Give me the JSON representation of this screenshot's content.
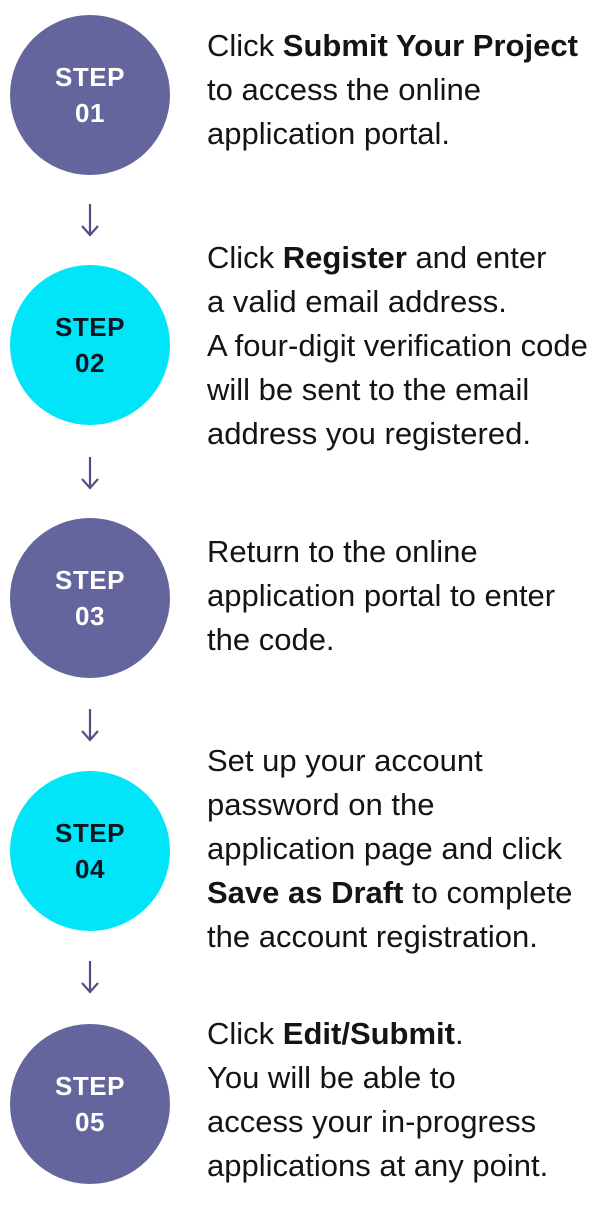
{
  "colors": {
    "purple_circle": "#64659c",
    "cyan_circle": "#00e5f7",
    "arrow": "#4f4f86"
  },
  "steps": [
    {
      "label": "STEP",
      "number": "01",
      "lines": [
        [
          {
            "t": "Click "
          },
          {
            "t": "Submit Your Project",
            "b": true
          }
        ],
        [
          {
            "t": "to access the online"
          }
        ],
        [
          {
            "t": "application portal."
          }
        ]
      ]
    },
    {
      "label": "STEP",
      "number": "02",
      "lines": [
        [
          {
            "t": "Click "
          },
          {
            "t": "Register",
            "b": true
          },
          {
            "t": " and enter"
          }
        ],
        [
          {
            "t": "a valid email address."
          }
        ],
        [
          {
            "t": "A four-digit verification code"
          }
        ],
        [
          {
            "t": "will be sent to the email"
          }
        ],
        [
          {
            "t": "address you registered."
          }
        ]
      ]
    },
    {
      "label": "STEP",
      "number": "03",
      "lines": [
        [
          {
            "t": "Return to the online"
          }
        ],
        [
          {
            "t": "application portal to enter"
          }
        ],
        [
          {
            "t": "the code."
          }
        ]
      ]
    },
    {
      "label": "STEP",
      "number": "04",
      "lines": [
        [
          {
            "t": "Set up your account"
          }
        ],
        [
          {
            "t": "password on the"
          }
        ],
        [
          {
            "t": "application page and click"
          }
        ],
        [
          {
            "t": "Save as Draft",
            "b": true
          },
          {
            "t": " to complete"
          }
        ],
        [
          {
            "t": "the account registration."
          }
        ]
      ]
    },
    {
      "label": "STEP",
      "number": "05",
      "lines": [
        [
          {
            "t": "Click "
          },
          {
            "t": "Edit/Submit",
            "b": true
          },
          {
            "t": "."
          }
        ],
        [
          {
            "t": "You will be able to"
          }
        ],
        [
          {
            "t": "access your in-progress"
          }
        ],
        [
          {
            "t": "applications at any point."
          }
        ]
      ]
    }
  ]
}
